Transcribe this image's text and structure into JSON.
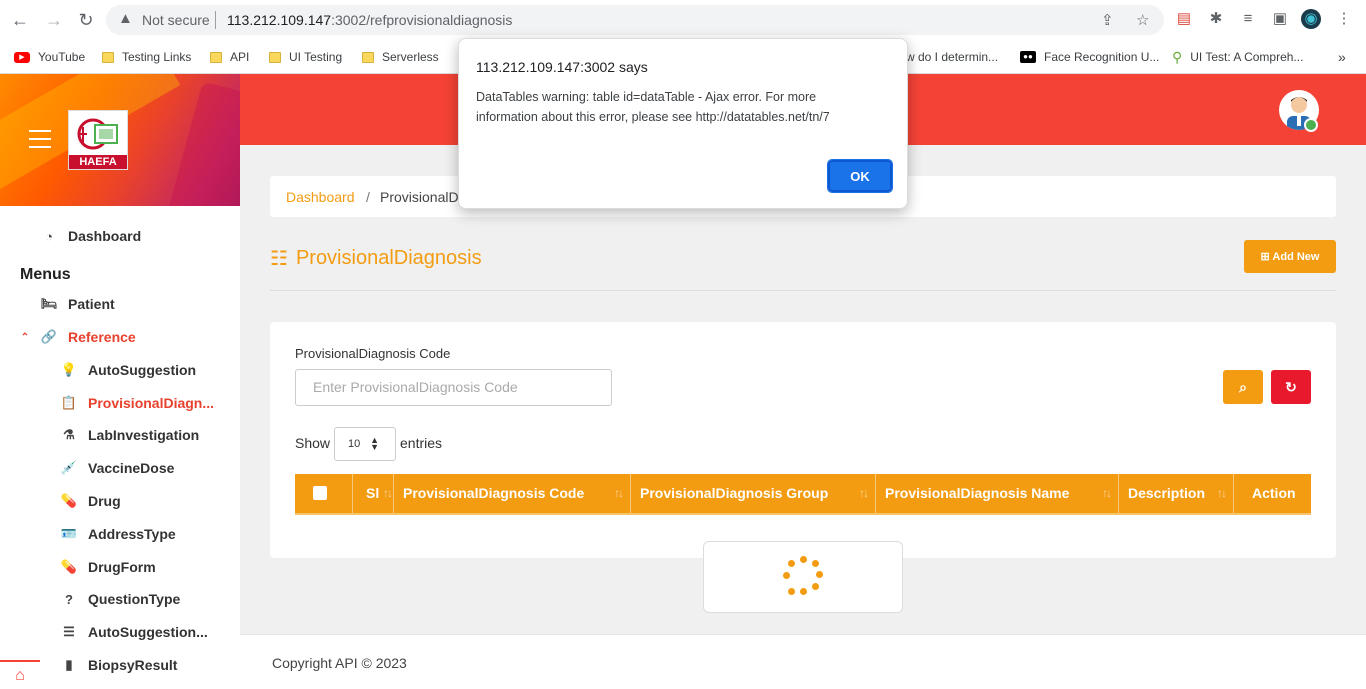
{
  "browser": {
    "security_label": "Not secure",
    "url_host": "113.212.109.147",
    "url_rest": ":3002/refprovisionaldiagnosis",
    "bookmarks": [
      "YouTube",
      "Testing Links",
      "API",
      "UI Testing",
      "Serverless",
      "w do I determin...",
      "Face Recognition U...",
      "UI Test: A Compreh..."
    ]
  },
  "dialog": {
    "title": "113.212.109.147:3002 says",
    "message": "DataTables warning: table id=dataTable - Ajax error. For more information about this error, please see http://datatables.net/tn/7",
    "ok_label": "OK"
  },
  "sidebar": {
    "logo_text": "HAEFA",
    "dashboard": "Dashboard",
    "menus_title": "Menus",
    "items": [
      {
        "label": "Patient",
        "icon": "bed-icon"
      },
      {
        "label": "Reference",
        "icon": "link-icon"
      },
      {
        "label": "AutoSuggestion",
        "icon": "lightbulb-icon"
      },
      {
        "label": "ProvisionalDiagn...",
        "icon": "clipboard-icon"
      },
      {
        "label": "LabInvestigation",
        "icon": "flask-icon"
      },
      {
        "label": "VaccineDose",
        "icon": "syringe-icon"
      },
      {
        "label": "Drug",
        "icon": "pills-icon"
      },
      {
        "label": "AddressType",
        "icon": "id-card-icon"
      },
      {
        "label": "DrugForm",
        "icon": "pills-icon"
      },
      {
        "label": "QuestionType",
        "icon": "question-icon"
      },
      {
        "label": "AutoSuggestion...",
        "icon": "list-icon"
      },
      {
        "label": "BiopsyResult",
        "icon": "file-icon"
      }
    ]
  },
  "breadcrumb": {
    "home": "Dashboard",
    "sep": "/",
    "current": "ProvisionalD"
  },
  "page": {
    "title": "ProvisionalDiagnosis",
    "add_new": "Add New"
  },
  "filter": {
    "label": "ProvisionalDiagnosis Code",
    "placeholder": "Enter ProvisionalDiagnosis Code"
  },
  "table": {
    "show": "Show",
    "page_size": "10",
    "entries": "entries",
    "columns": [
      "Sl",
      "ProvisionalDiagnosis Code",
      "ProvisionalDiagnosis Group",
      "ProvisionalDiagnosis Name",
      "Description",
      "Action"
    ]
  },
  "footer": {
    "copyright": "Copyright API © 2023"
  },
  "colors": {
    "accent": "#f39c12",
    "topbar": "#f44336",
    "active": "#e8412d"
  }
}
